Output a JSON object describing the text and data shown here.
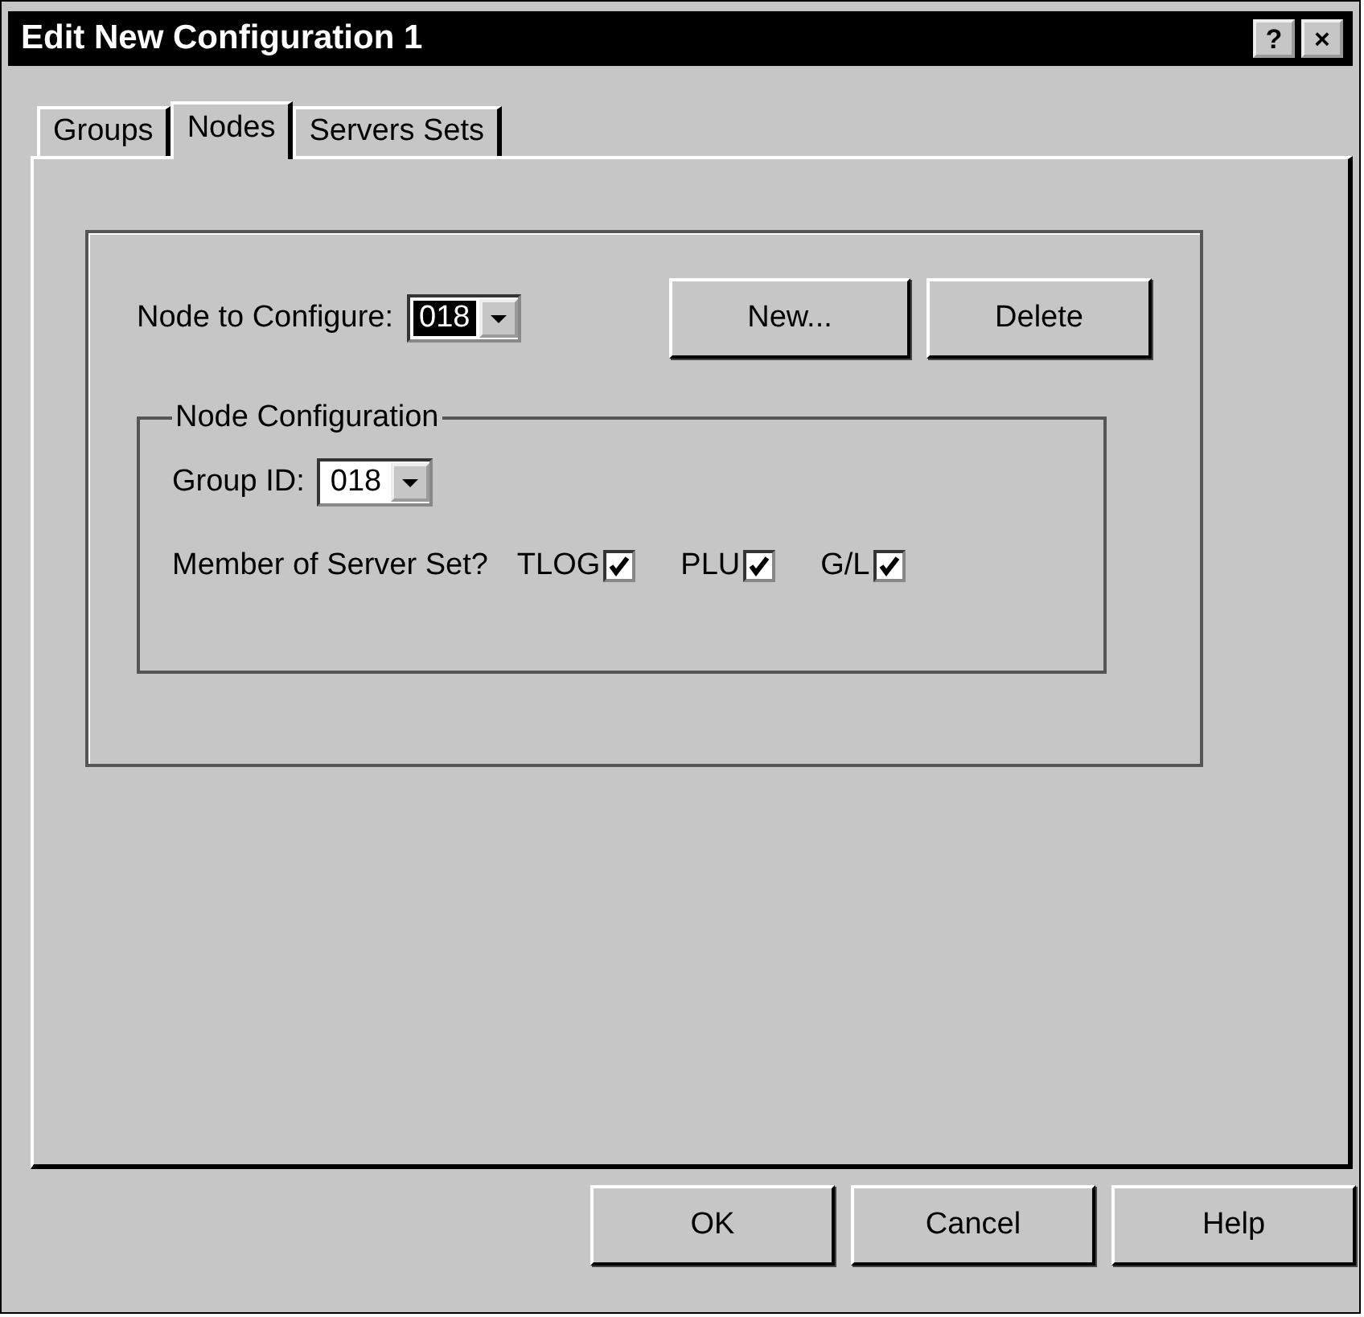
{
  "window": {
    "title": "Edit New Configuration 1",
    "help_button": "?",
    "close_button": "×"
  },
  "tabs": [
    {
      "label": "Groups",
      "selected": false
    },
    {
      "label": "Nodes",
      "selected": true
    },
    {
      "label": "Servers Sets",
      "selected": false
    }
  ],
  "node_row": {
    "label": "Node to Configure:",
    "combo": {
      "value": "018",
      "highlighted": true
    },
    "buttons": [
      "New...",
      "Delete"
    ]
  },
  "node_configuration": {
    "title": "Node Configuration",
    "group_id": {
      "label": "Group ID:",
      "combo": {
        "value": "018",
        "highlighted": false
      }
    },
    "member_label": "Member of Server Set?",
    "server_sets": [
      {
        "label": "TLOG",
        "checked": true
      },
      {
        "label": "PLU",
        "checked": true
      },
      {
        "label": "G/L",
        "checked": true
      }
    ]
  },
  "buttons": [
    "OK",
    "Cancel",
    "Help"
  ]
}
